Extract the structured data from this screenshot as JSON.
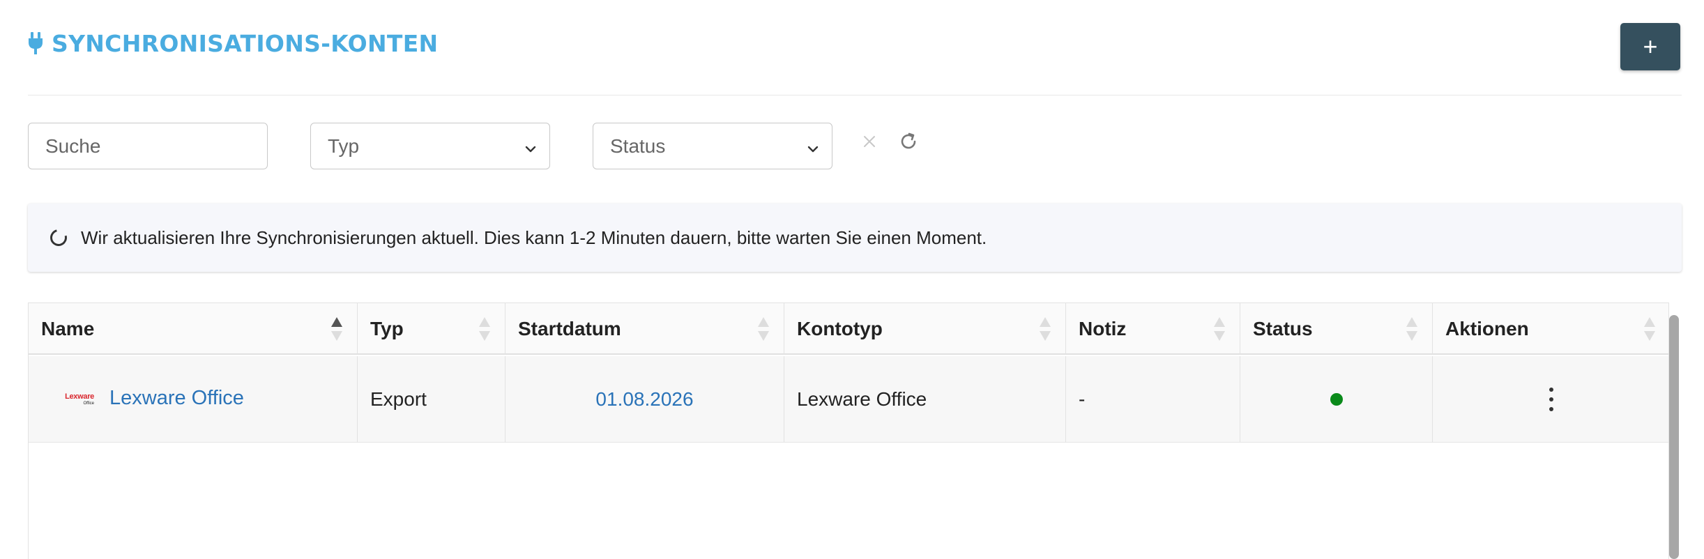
{
  "header": {
    "title": "SYNCHRONISATIONS-KONTEN",
    "title_icon": "plug-icon",
    "add_button_label": "+",
    "accent_color": "#4aace0",
    "button_color": "#35505e"
  },
  "filters": {
    "search_placeholder": "Suche",
    "type_placeholder": "Typ",
    "status_placeholder": "Status",
    "clear_icon": "close-icon",
    "refresh_icon": "refresh-icon"
  },
  "notice": {
    "icon": "spinner-icon",
    "text": "Wir aktualisieren Ihre Synchronisierungen aktuell. Dies kann 1-2 Minuten dauern, bitte warten Sie einen Moment."
  },
  "table": {
    "columns": [
      "Name",
      "Typ",
      "Startdatum",
      "Kontotyp",
      "Notiz",
      "Status",
      "Aktionen"
    ],
    "rows": [
      {
        "logo_text": "Lexware",
        "logo_subtext": "Office",
        "name": "Lexware Office",
        "type": "Export",
        "start_date": "01.08.2026",
        "account_type": "Lexware Office",
        "note": "-",
        "status": "active",
        "status_color": "#0a8a1a",
        "actions_icon": "kebab-menu-icon"
      }
    ]
  }
}
